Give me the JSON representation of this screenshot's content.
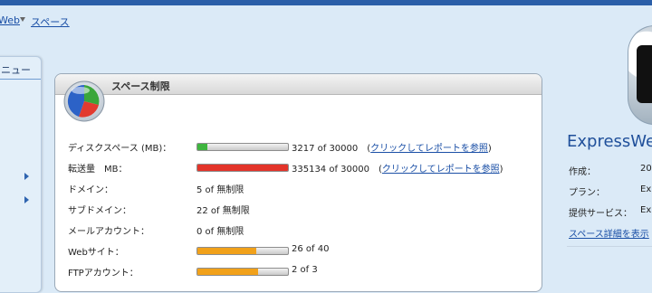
{
  "breadcrumb": {
    "items": [
      "Web",
      "スペース"
    ]
  },
  "sidebar": {
    "title": "ニュー"
  },
  "panel": {
    "title": "スペース制限",
    "rows": [
      {
        "label": "ディスクスペース (MB)：",
        "value": "3217 of 30000",
        "link": "クリックしてレポートを参照",
        "usage": 0.107,
        "color": "#3fb53f"
      },
      {
        "label": "転送量　MB：",
        "value": "335134 of 30000",
        "link": "クリックしてレポートを参照",
        "usage": 1.0,
        "color": "#e3342a"
      },
      {
        "label": "ドメイン：",
        "value": "5 of 無制限"
      },
      {
        "label": "サブドメイン：",
        "value": "22 of 無制限"
      },
      {
        "label": "メールアカウント：",
        "value": "0 of 無制限"
      },
      {
        "label": "Webサイト：",
        "value": "26 of 40",
        "usage": 0.65,
        "color": "#f1a11a"
      },
      {
        "label": "FTPアカウント：",
        "value": "2 of 3",
        "usage": 0.67,
        "color": "#f1a11a"
      }
    ]
  },
  "plan": {
    "title": "ExpressWeb",
    "items": [
      {
        "key": "作成：",
        "val": "20"
      },
      {
        "key": "プラン：",
        "val": "Ex"
      },
      {
        "key": "提供サービス：",
        "val": "Ex"
      }
    ],
    "details_link": "スペース詳細を表示"
  },
  "colors": {
    "accent": "#2a5ea8",
    "link": "#1a4fa6",
    "background": "#dbeaf7"
  }
}
